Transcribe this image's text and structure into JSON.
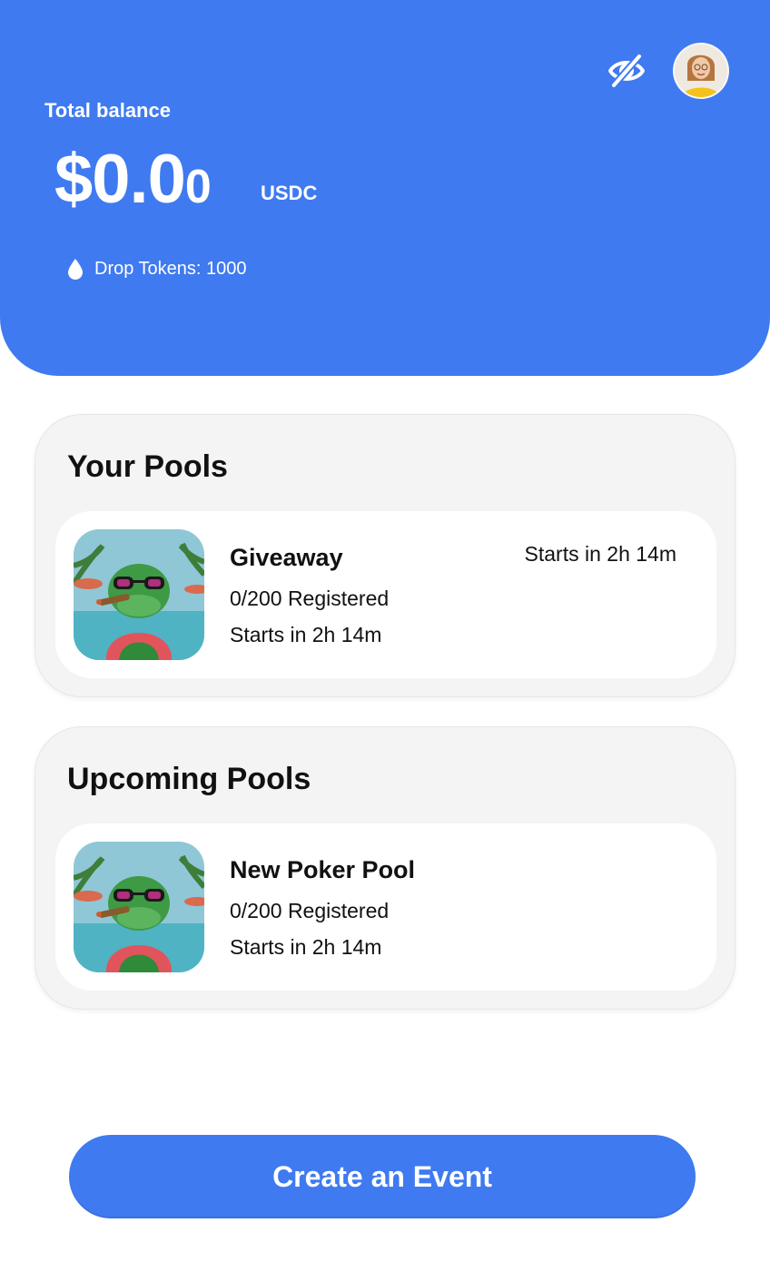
{
  "header": {
    "balance_label": "Total balance",
    "balance_main": "$0.0",
    "balance_small": "0",
    "currency": "USDC",
    "tokens_text": "Drop Tokens: 1000",
    "accent_color": "#3f7af0",
    "icons": {
      "visibility": "eye-off-icon",
      "tokens": "drop-icon",
      "avatar": "user-avatar"
    }
  },
  "your_pools": {
    "title": "Your Pools",
    "items": [
      {
        "name": "Giveaway",
        "registered": "0/200 Registered",
        "starts": "Starts in 2h 14m",
        "starts_right": "Starts in 2h 14m"
      }
    ]
  },
  "upcoming_pools": {
    "title": "Upcoming Pools",
    "items": [
      {
        "name": "New Poker Pool",
        "registered": "0/200 Registered",
        "starts": "Starts in 2h 14m"
      }
    ]
  },
  "cta": {
    "label": "Create an Event"
  }
}
